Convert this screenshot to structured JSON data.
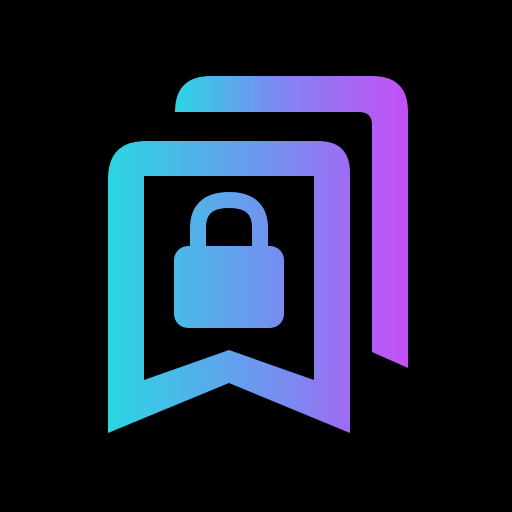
{
  "icon": {
    "name": "locked-bookmarks-icon",
    "background_color": "#000000",
    "gradient": {
      "start": "#2ad6e2",
      "mid": "#7f86f2",
      "end": "#c44ff5"
    },
    "layers": [
      "back-bookmark-outline",
      "front-bookmark-outline",
      "lock-glyph"
    ]
  }
}
